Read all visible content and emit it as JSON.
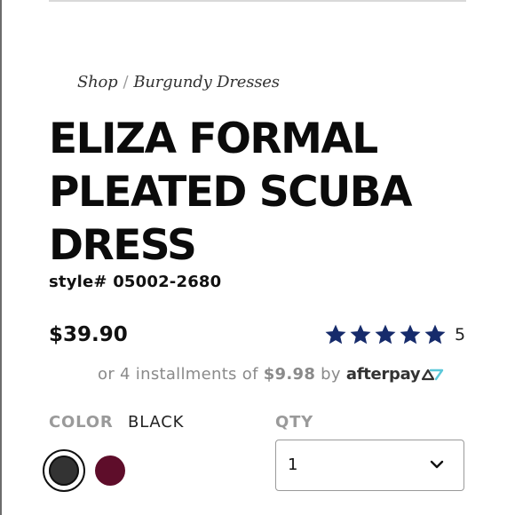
{
  "breadcrumb": {
    "items": [
      "Shop",
      "Burgundy Dresses"
    ],
    "separator": "/"
  },
  "product": {
    "title": "ELIZA FORMAL PLEATED SCUBA DRESS",
    "style_label": "style#",
    "style_number": "05002-2680",
    "price": "$39.90"
  },
  "rating": {
    "stars": 5,
    "max_stars": 5,
    "count": "5",
    "star_color": "#162b6b"
  },
  "installments": {
    "prefix": "or 4 installments of",
    "amount": "$9.98",
    "by": "by",
    "provider": "afterpay"
  },
  "color": {
    "label": "COLOR",
    "selected": "BLACK",
    "swatches": [
      {
        "name": "Black",
        "hex": "#333333",
        "selected": true
      },
      {
        "name": "Burgundy",
        "hex": "#5e0d2a",
        "selected": false
      }
    ]
  },
  "qty": {
    "label": "QTY",
    "value": "1"
  },
  "icons": {
    "star": "star-icon",
    "chevron": "chevron-down-icon",
    "afterpay": "afterpay-arrows-icon"
  }
}
